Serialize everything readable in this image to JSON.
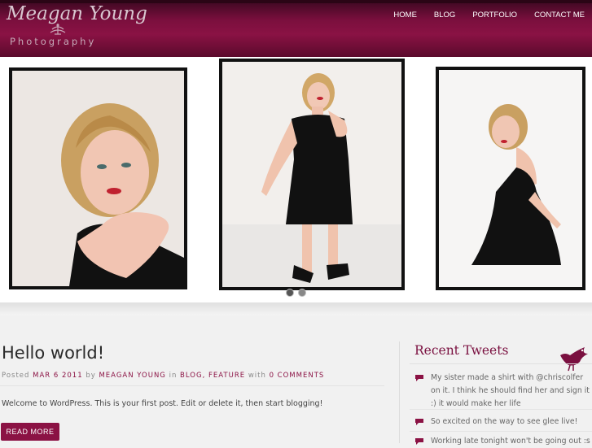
{
  "header": {
    "logo_script": "Meagan Young",
    "logo_sub": "Photography",
    "nav": [
      "HOME",
      "BLOG",
      "PORTFOLIO",
      "CONTACT ME"
    ]
  },
  "colors": {
    "accent": "#8b1244",
    "header": "#7a0f3d"
  },
  "gallery": {
    "images": [
      "woman-portrait-close",
      "woman-standing-black-dress",
      "woman-sitting-black-dress"
    ],
    "active_slide": 1,
    "slide_count": 2
  },
  "post": {
    "title": "Hello world!",
    "meta_posted": "Posted",
    "meta_date": "MAR 6 2011",
    "meta_by": "by",
    "meta_author": "MEAGAN YOUNG",
    "meta_in": "in",
    "meta_cat1": "BLOG",
    "meta_cat2": "FEATURE",
    "meta_with": "with",
    "meta_comments": "0 COMMENTS",
    "body": "Welcome to WordPress. This is your first post. Edit or delete it, then start blogging!",
    "read_more": "READ MORE"
  },
  "sidebar": {
    "title": "Recent Tweets",
    "tweets": [
      "My sister made a shirt with @chriscolfer on it. I think he should find her and sign it :) it would make her life",
      "So excited on the way to see glee live!",
      "Working late tonight won't be going out :s"
    ]
  }
}
